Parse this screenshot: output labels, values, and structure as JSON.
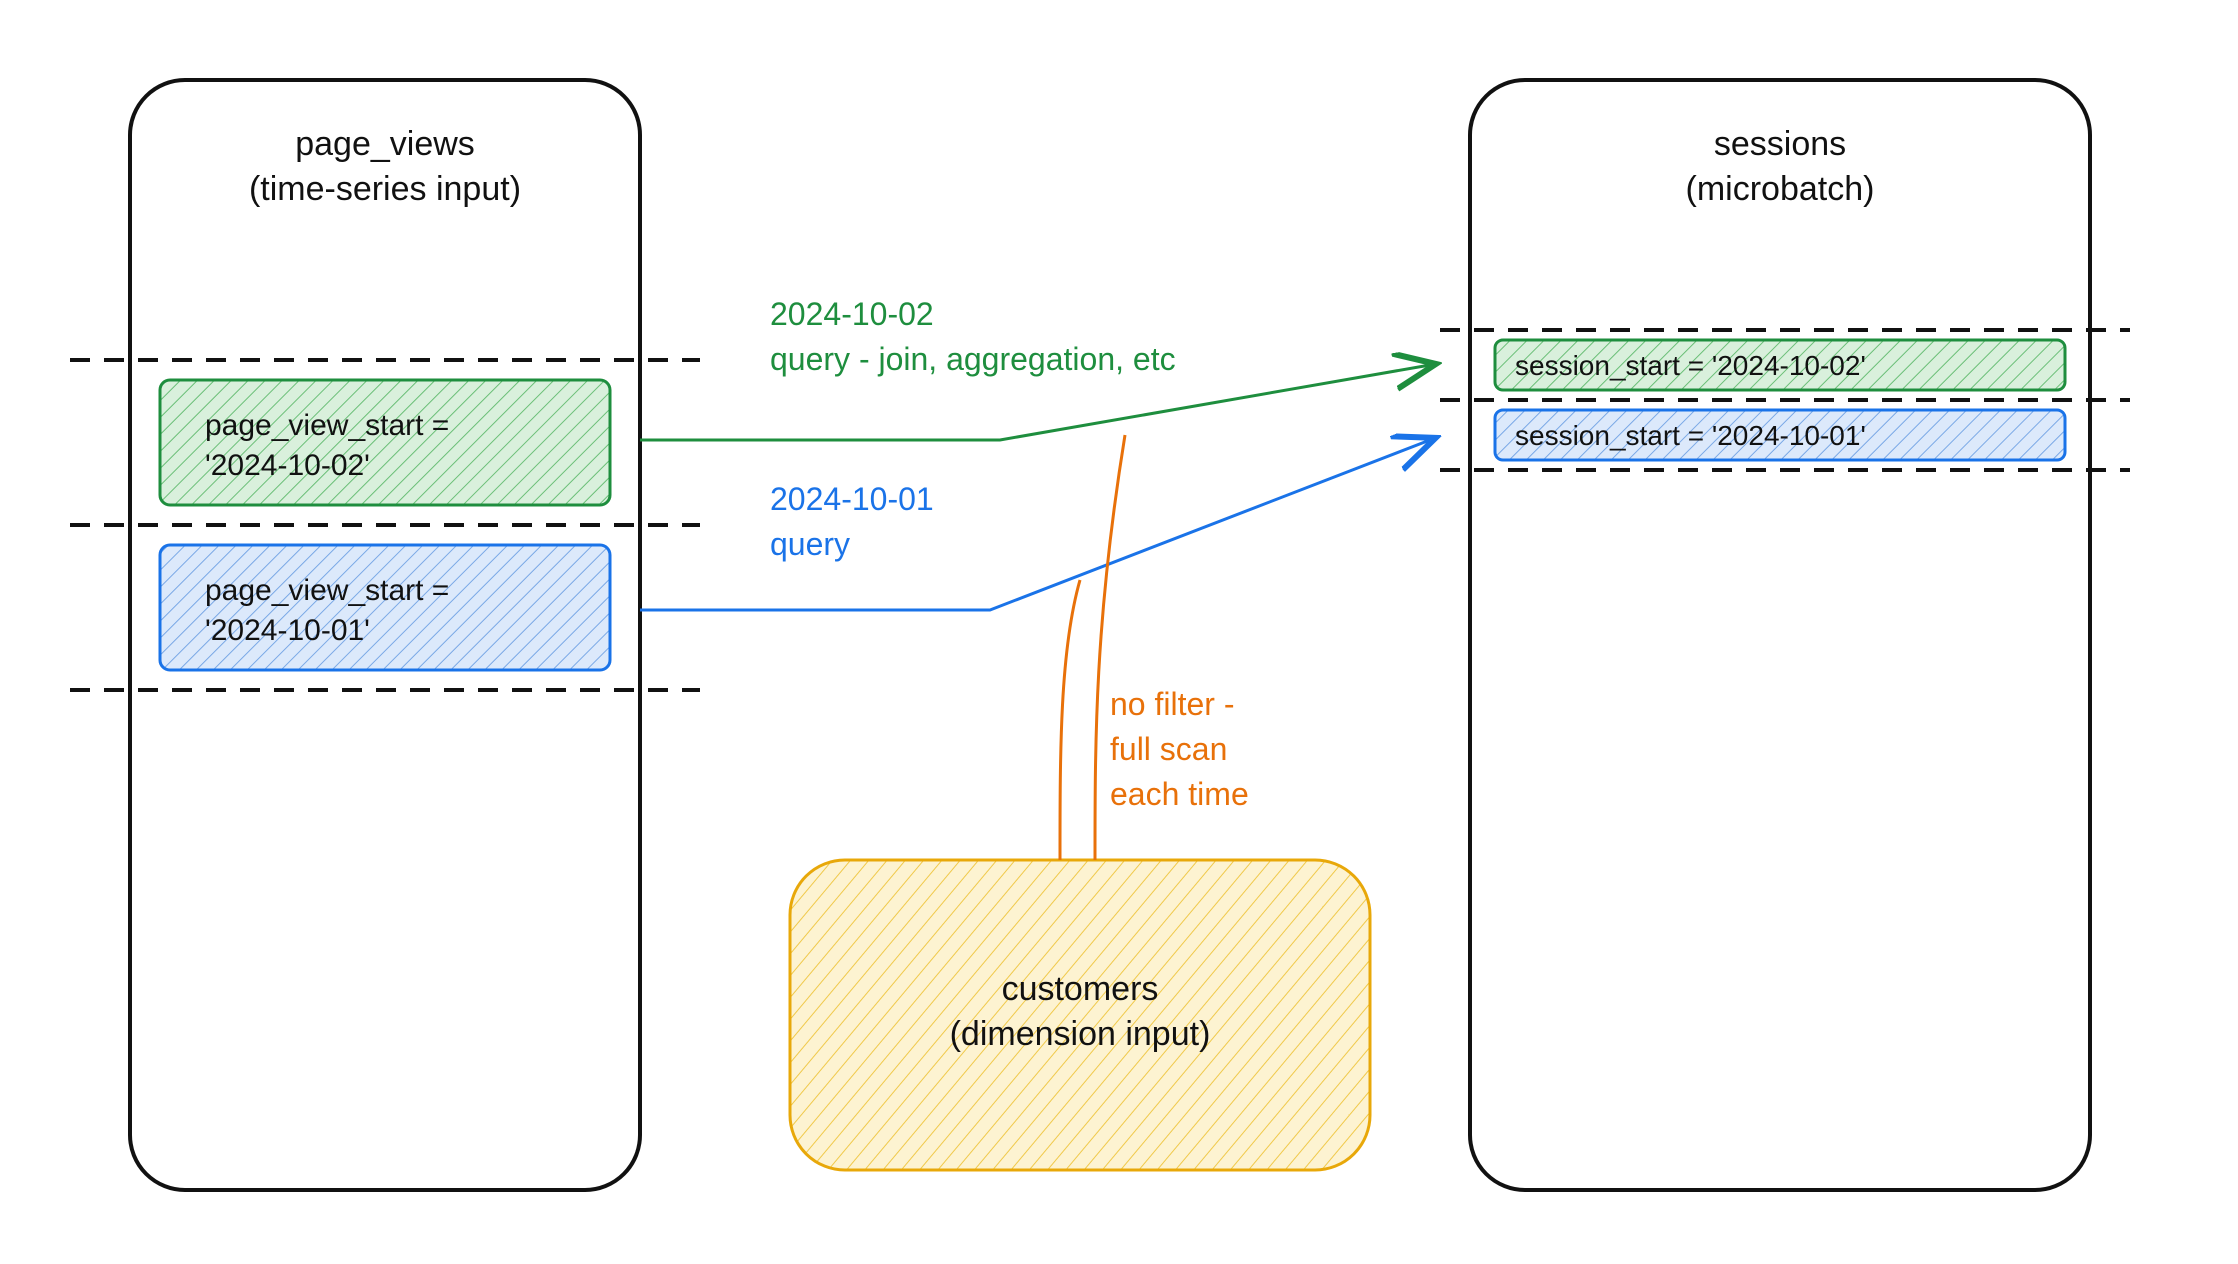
{
  "left_box": {
    "title_line1": "page_views",
    "title_line2": "(time-series input)",
    "row_green_line1": "page_view_start =",
    "row_green_line2": "'2024-10-02'",
    "row_blue_line1": "page_view_start =",
    "row_blue_line2": "'2024-10-01'"
  },
  "right_box": {
    "title_line1": "sessions",
    "title_line2": "(microbatch)",
    "row_green": "session_start = '2024-10-02'",
    "row_blue": "session_start = '2024-10-01'"
  },
  "center_box": {
    "title_line1": "customers",
    "title_line2": "(dimension input)"
  },
  "annotations": {
    "green_line1": "2024-10-02",
    "green_line2": "query - join, aggregation, etc",
    "blue_line1": "2024-10-01",
    "blue_line2": "query",
    "orange_line1": "no filter -",
    "orange_line2": "full scan",
    "orange_line3": "each time"
  },
  "colors": {
    "green": "#1e8e3e",
    "blue": "#1a73e8",
    "orange": "#e8710a",
    "yellow": "#f9d66b",
    "ink": "#111111"
  }
}
